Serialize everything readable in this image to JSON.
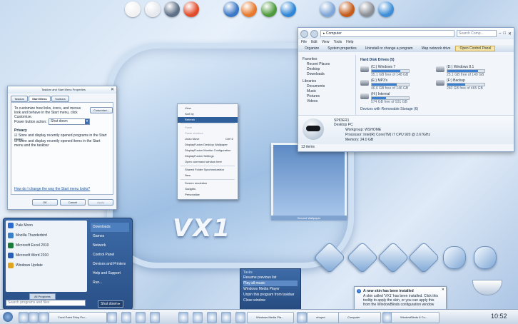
{
  "colors": {
    "accent": "#2f5f9a",
    "drive_bar": "#3a7fd0",
    "start_menu": "#2d5a93"
  },
  "dock_icons": [
    "robot-icon",
    "notepad-icon",
    "globe-icon",
    "checklist-icon",
    "sphere-icon",
    "firefox-icon",
    "maps-icon",
    "monitor-icon",
    "save-icon",
    "media-icon",
    "tools-icon",
    "browser-icon"
  ],
  "taskbar_dialog": {
    "title": "Taskbar and Start Menu Properties",
    "tabs": [
      "Taskbar",
      "Start Menu",
      "Toolbars"
    ],
    "description": "To customize how links, icons, and menus look and behave in the Start menu, click Customize.",
    "customize": "Customize...",
    "power_label": "Power button action:",
    "power_value": "Shut down",
    "privacy": "Privacy",
    "check1": "Store and display recently opened programs in the Start menu",
    "check2": "Store and display recently opened items in the Start menu and the taskbar",
    "link": "How do I change the way the Start menu looks?",
    "ok": "OK",
    "cancel": "Cancel",
    "apply": "Apply"
  },
  "context_menu": {
    "items": [
      {
        "label": "View"
      },
      {
        "label": "Sort by"
      },
      {
        "label": "Refresh",
        "hi": true
      },
      {
        "sep": true
      },
      {
        "label": "Paste",
        "dis": true
      },
      {
        "label": "Paste shortcut",
        "dis": true
      },
      {
        "label": "Undo Move"
      },
      {
        "label": "DisplayFusion Desktop Wallpaper"
      },
      {
        "label": "DisplayFusion Monitor Configuration"
      },
      {
        "label": "DisplayFusion Settings"
      },
      {
        "label": "Open command window here"
      },
      {
        "sep": true
      },
      {
        "label": "Shared Folder Synchronization"
      },
      {
        "label": "New"
      },
      {
        "sep": true
      },
      {
        "label": "Screen resolution"
      },
      {
        "label": "Gadgets"
      },
      {
        "label": "Personalize"
      }
    ],
    "undo_shortcut": "Ctrl+Z"
  },
  "explorer": {
    "address": "Computer",
    "search": "Search Comp...",
    "menu": [
      "File",
      "Edit",
      "View",
      "Tools",
      "Help"
    ],
    "toolbar": [
      "Organize",
      "System properties",
      "Uninstall or change a program",
      "Map network drive",
      "Open Control Panel"
    ],
    "nav": [
      "Favorites",
      "Recent Places",
      "Desktop",
      "Downloads",
      "Libraries",
      "Documents",
      "Music",
      "Pictures",
      "Videos"
    ],
    "section1": "Hard Disk Drives (5)",
    "drives": [
      {
        "name": "(C:) Windows 7",
        "free": "35.1 GB free of 148 GB",
        "fill": 76
      },
      {
        "name": "(D:) Windows 8.1",
        "free": "25.1 GB free of 149 GB",
        "fill": 83
      },
      {
        "name": "(E:) MP3's",
        "free": "46.6 GB free of 146 GB",
        "fill": 68
      },
      {
        "name": "(F:) Backup",
        "free": "240 GB free of 465 GB",
        "fill": 48
      },
      {
        "name": "(H:) Internal",
        "free": "574 GB free of 931 GB",
        "fill": 38
      }
    ],
    "section2": "Devices with Removable Storage (6)",
    "pc_name": "SPIDER1",
    "pc_sub": "Desktop PC",
    "workgroup": "Workgroup: WSHOME",
    "processor": "Processor: Intel(R) Core(TM) i7 CPU   920 @ 2.67GHz",
    "memory": "Memory: 24.0 GB",
    "items": "13 items"
  },
  "start_menu": {
    "left": [
      "Pale Moon",
      "Mozilla Thunderbird",
      "Microsoft Excel 2010",
      "Microsoft Word 2010",
      "Windows Update"
    ],
    "all_programs": "All Programs",
    "search_placeholder": "Search programs and files",
    "right": [
      "Downloads",
      "Games",
      "Network",
      "Control Panel",
      "Devices and Printers",
      "Help and Support",
      "Run..."
    ],
    "shutdown": "Shut down"
  },
  "wallpaper_label": "Second Wallpaper",
  "logo": "VX1",
  "jumplist": {
    "title": "Tasks",
    "items": [
      "Resume previous list",
      "Play all music",
      "Windows Media Player",
      "Unpin this program from taskbar",
      "Close window"
    ]
  },
  "balloon": {
    "title": "A new skin has been installed",
    "text": "A skin called 'VX1' has been installed. Click this tooltip to apply the skin, or you can apply this from the WindowBlinds configuration window"
  },
  "taskbar": {
    "items": [
      "Corel Paint Shop Pro...",
      "Windows Media Pla...",
      "ohuyev",
      "Computer",
      "WindowBlinds 8 Co..."
    ],
    "clock": "10:52"
  }
}
